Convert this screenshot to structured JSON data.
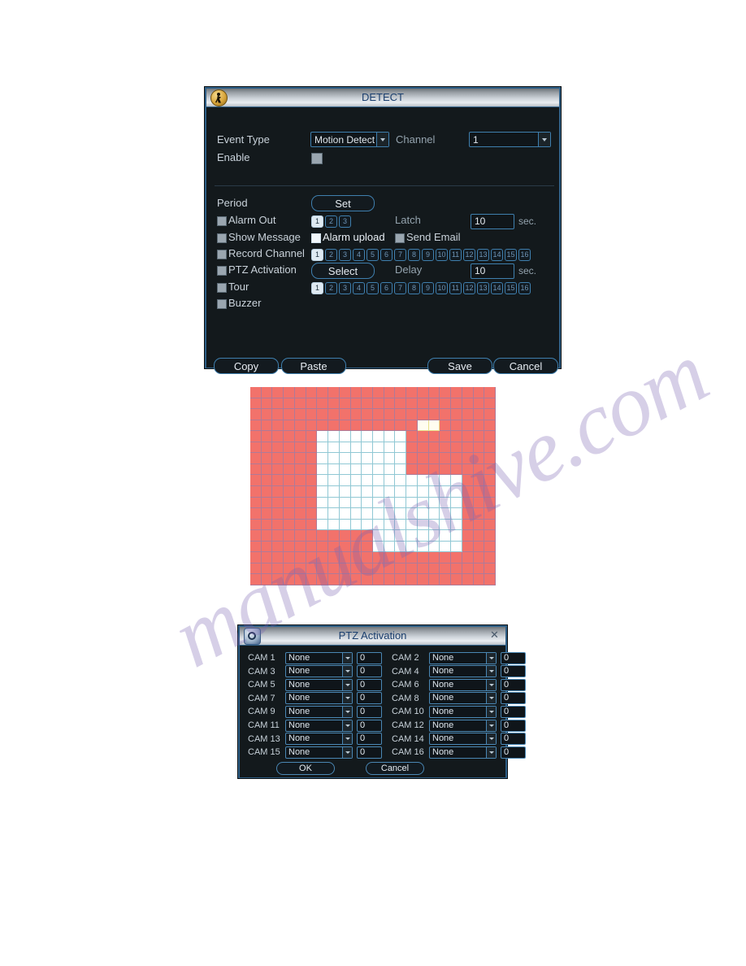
{
  "watermark": {
    "text": "manualshive.com"
  },
  "detect_dialog": {
    "title": "DETECT",
    "icon": "person-walking-icon",
    "event_type_label": "Event Type",
    "event_type_value": "Motion Detect",
    "channel_label": "Channel",
    "channel_value": "1",
    "enable_label": "Enable",
    "enable_checked": false,
    "period_label": "Period",
    "set_button": "Set",
    "alarm_out_label": "Alarm Out",
    "alarm_out_channels": [
      "1",
      "2",
      "3"
    ],
    "alarm_out_active": [
      true,
      false,
      false
    ],
    "latch_label": "Latch",
    "latch_value": "10",
    "latch_unit": "sec.",
    "show_message_label": "Show Message",
    "alarm_upload_label": "Alarm upload",
    "alarm_upload_checked": true,
    "send_email_label": "Send Email",
    "record_channel_label": "Record Channel",
    "record_channels": [
      "1",
      "2",
      "3",
      "4",
      "5",
      "6",
      "7",
      "8",
      "9",
      "10",
      "11",
      "12",
      "13",
      "14",
      "15",
      "16"
    ],
    "record_channels_active": [
      true,
      false,
      false,
      false,
      false,
      false,
      false,
      false,
      false,
      false,
      false,
      false,
      false,
      false,
      false,
      false
    ],
    "ptz_activation_label": "PTZ Activation",
    "select_button": "Select",
    "delay_label": "Delay",
    "delay_value": "10",
    "delay_unit": "sec.",
    "tour_label": "Tour",
    "tour_channels": [
      "1",
      "2",
      "3",
      "4",
      "5",
      "6",
      "7",
      "8",
      "9",
      "10",
      "11",
      "12",
      "13",
      "14",
      "15",
      "16"
    ],
    "tour_channels_active": [
      true,
      false,
      false,
      false,
      false,
      false,
      false,
      false,
      false,
      false,
      false,
      false,
      false,
      false,
      false,
      false
    ],
    "buzzer_label": "Buzzer",
    "copy_button": "Copy",
    "paste_button": "Paste",
    "save_button": "Save",
    "cancel_button": "Cancel"
  },
  "motion_grid": {
    "cols": 22,
    "rows": 18,
    "armed_color": "#f2726b",
    "cleared_color": "#ffffff",
    "gridline_color": "#7a82be",
    "cleared_regions": [
      {
        "col_start": 6,
        "col_end": 13,
        "row_start": 4,
        "row_end": 12
      },
      {
        "col_start": 11,
        "col_end": 18,
        "row_start": 8,
        "row_end": 14
      }
    ],
    "highlight_cells": [
      {
        "col": 15,
        "row": 3
      },
      {
        "col": 16,
        "row": 3
      }
    ]
  },
  "ptz_dialog": {
    "title": "PTZ Activation",
    "icon": "ptz-camera-icon",
    "close_icon": "close-icon",
    "rows": [
      {
        "left_label": "CAM 1",
        "left_value": "None",
        "left_num": "0",
        "right_label": "CAM 2",
        "right_value": "None",
        "right_num": "0"
      },
      {
        "left_label": "CAM 3",
        "left_value": "None",
        "left_num": "0",
        "right_label": "CAM 4",
        "right_value": "None",
        "right_num": "0"
      },
      {
        "left_label": "CAM 5",
        "left_value": "None",
        "left_num": "0",
        "right_label": "CAM 6",
        "right_value": "None",
        "right_num": "0"
      },
      {
        "left_label": "CAM 7",
        "left_value": "None",
        "left_num": "0",
        "right_label": "CAM 8",
        "right_value": "None",
        "right_num": "0"
      },
      {
        "left_label": "CAM 9",
        "left_value": "None",
        "left_num": "0",
        "right_label": "CAM 10",
        "right_value": "None",
        "right_num": "0"
      },
      {
        "left_label": "CAM 11",
        "left_value": "None",
        "left_num": "0",
        "right_label": "CAM 12",
        "right_value": "None",
        "right_num": "0"
      },
      {
        "left_label": "CAM 13",
        "left_value": "None",
        "left_num": "0",
        "right_label": "CAM 14",
        "right_value": "None",
        "right_num": "0"
      },
      {
        "left_label": "CAM 15",
        "left_value": "None",
        "left_num": "0",
        "right_label": "CAM 16",
        "right_value": "None",
        "right_num": "0"
      }
    ],
    "ok_button": "OK",
    "cancel_button": "Cancel"
  }
}
